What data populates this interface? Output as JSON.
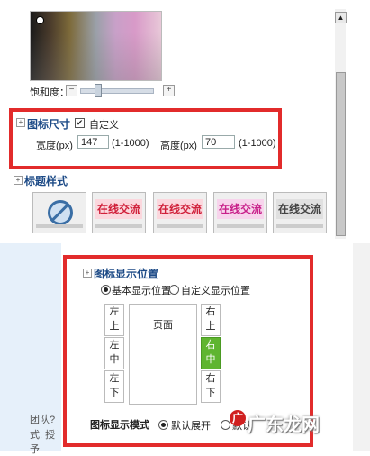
{
  "saturation": {
    "label": "饱和度：",
    "minus": "−",
    "plus": "+"
  },
  "icon_size": {
    "title": "图标尺寸",
    "custom_label": "自定义",
    "width_label": "宽度(px)",
    "width_value": "147",
    "width_range": "(1-1000)",
    "height_label": "高度(px)",
    "height_value": "70",
    "height_range": "(1-1000)"
  },
  "title_style": {
    "title": "标题样式",
    "options": [
      "在线交流",
      "在线交流",
      "在线交流",
      "在线交流"
    ]
  },
  "display_position": {
    "title": "图标显示位置",
    "basic_label": "基本显示位置",
    "custom_label": "自定义显示位置",
    "left_top": "左\n上",
    "left_mid": "左\n中",
    "left_bottom": "左\n下",
    "right_top": "右\n上",
    "right_mid": "右\n中",
    "right_bottom": "右\n下",
    "page_label": "页面",
    "mode_label": "图标显示模式",
    "mode_default": "默认展开",
    "mode_other": "默认"
  },
  "left_text": {
    "line1": "团队?",
    "line2": "式. 授予"
  },
  "watermark": {
    "text": "广东龙网"
  },
  "colors": {
    "accent_red": "#e22b2b",
    "selected_green": "#5fb530",
    "title_blue": "#1c4a86"
  }
}
